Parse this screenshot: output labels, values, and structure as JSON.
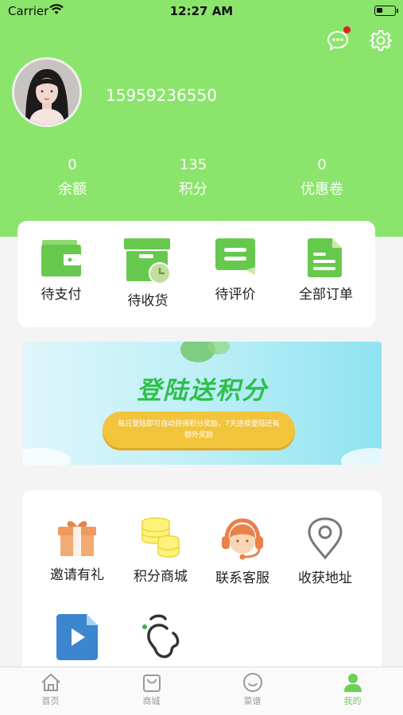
{
  "status_bar": {
    "carrier": "Carrier",
    "time": "12:27 AM"
  },
  "profile": {
    "phone": "15959236550"
  },
  "stats": [
    {
      "value": "0",
      "label": "余额"
    },
    {
      "value": "135",
      "label": "积分"
    },
    {
      "value": "0",
      "label": "优惠卷"
    }
  ],
  "orders": [
    {
      "label": "待支付",
      "icon": "wallet-icon"
    },
    {
      "label": "待收货",
      "icon": "box-clock-icon"
    },
    {
      "label": "待评价",
      "icon": "comment-icon"
    },
    {
      "label": "全部订单",
      "icon": "document-icon"
    }
  ],
  "banner": {
    "title": "登陆送积分",
    "text": "每日登陆即可自动获得积分奖励，7天连续登陆还有额外奖励"
  },
  "services": [
    {
      "label": "邀请有礼",
      "icon": "gift-icon"
    },
    {
      "label": "积分商城",
      "icon": "coins-icon"
    },
    {
      "label": "联系客服",
      "icon": "headset-icon"
    },
    {
      "label": "收获地址",
      "icon": "location-pin-icon"
    },
    {
      "label": "",
      "icon": "video-file-icon"
    },
    {
      "label": "",
      "icon": "doodle-icon"
    }
  ],
  "tabbar": [
    {
      "label": "首页",
      "icon": "home-icon",
      "active": false
    },
    {
      "label": "商城",
      "icon": "shopping-bag-icon",
      "active": false
    },
    {
      "label": "菜谱",
      "icon": "smile-icon",
      "active": false
    },
    {
      "label": "我的",
      "icon": "person-icon",
      "active": true
    }
  ],
  "colors": {
    "header": "#8be56c",
    "accent": "#6bd055",
    "notification": "#e41f1f",
    "tab_inactive": "#999999"
  }
}
